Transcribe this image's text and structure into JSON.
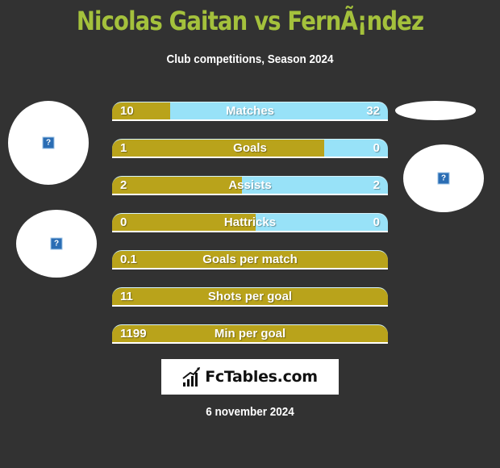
{
  "header": {
    "title": "Nicolas Gaitan vs FernÃ¡ndez",
    "subtitle": "Club competitions, Season 2024"
  },
  "colors": {
    "background": "#323232",
    "title": "#a4c13c",
    "left_player": "#b9a31b",
    "right_player": "#98e2f8"
  },
  "players": {
    "left": {
      "image_icon": "missing-image-icon",
      "image_glyph": "?"
    },
    "right": {
      "image_icon": "missing-image-icon",
      "image_glyph": "?"
    }
  },
  "stats": [
    {
      "label": "Matches",
      "left": "10",
      "right": "32",
      "left_share": 0.21
    },
    {
      "label": "Goals",
      "left": "1",
      "right": "0",
      "left_share": 0.77
    },
    {
      "label": "Assists",
      "left": "2",
      "right": "2",
      "left_share": 0.47
    },
    {
      "label": "Hattricks",
      "left": "0",
      "right": "0",
      "left_share": 0.52
    },
    {
      "label": "Goals per match",
      "left": "0.1",
      "right": "",
      "left_share": 1.0
    },
    {
      "label": "Shots per goal",
      "left": "11",
      "right": "",
      "left_share": 1.0
    },
    {
      "label": "Min per goal",
      "left": "1199",
      "right": "",
      "left_share": 1.0
    }
  ],
  "footer": {
    "logo_text": "FcTables.com",
    "date": "6 november 2024"
  }
}
